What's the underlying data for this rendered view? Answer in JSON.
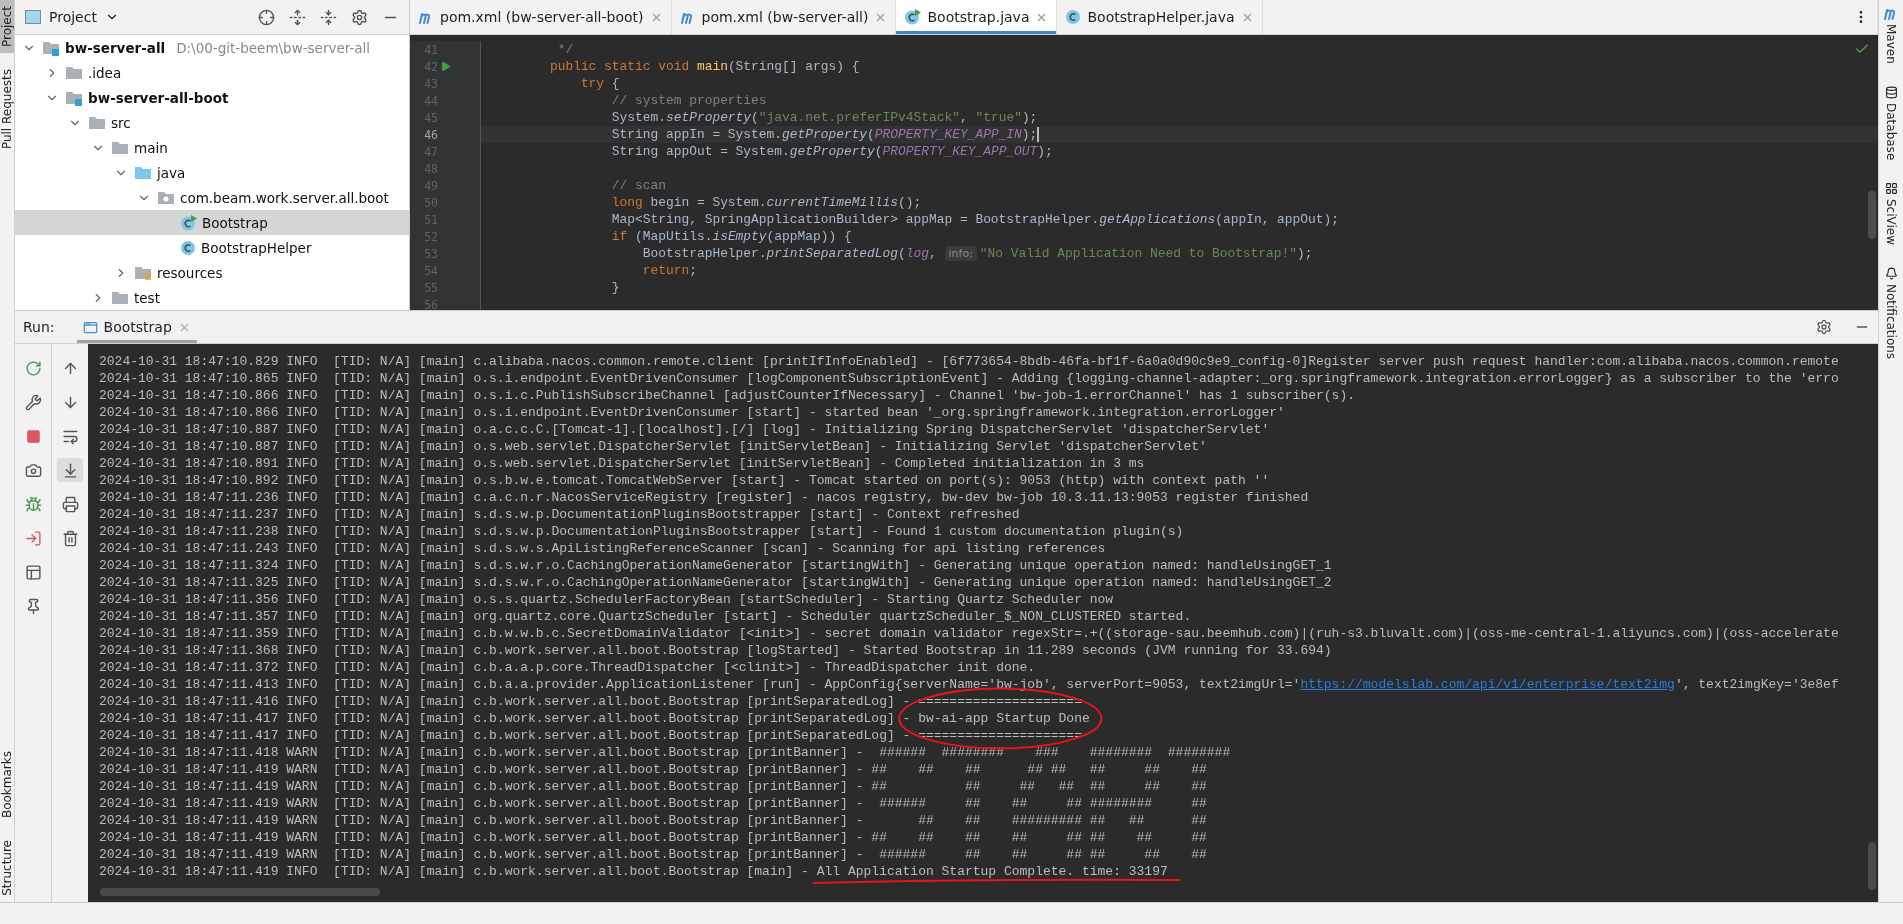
{
  "left_strip": [
    {
      "label": "Project",
      "selected": true
    },
    {
      "label": "Pull Requests",
      "selected": false
    },
    {
      "label": "Bookmarks",
      "selected": false
    },
    {
      "label": "Structure",
      "selected": false
    }
  ],
  "project": {
    "title": "Project",
    "tree": [
      {
        "label": "bw-server-all",
        "hint": "D:\\00-git-beem\\bw-server-all",
        "kind": "module",
        "expanded": true,
        "selected": false,
        "children": [
          {
            "label": ".idea",
            "kind": "folder",
            "expanded": false,
            "selected": false
          },
          {
            "label": "bw-server-all-boot",
            "kind": "module",
            "expanded": true,
            "selected": false,
            "children": [
              {
                "label": "src",
                "kind": "folder",
                "expanded": true,
                "selected": false,
                "children": [
                  {
                    "label": "main",
                    "kind": "folder",
                    "expanded": true,
                    "selected": false,
                    "children": [
                      {
                        "label": "java",
                        "kind": "source-folder",
                        "expanded": true,
                        "selected": false,
                        "children": [
                          {
                            "label": "com.beam.work.server.all.boot",
                            "kind": "package",
                            "expanded": true,
                            "selected": false,
                            "children": [
                              {
                                "label": "Bootstrap",
                                "kind": "class-run",
                                "selected": true
                              },
                              {
                                "label": "BootstrapHelper",
                                "kind": "class",
                                "selected": false
                              }
                            ]
                          }
                        ]
                      },
                      {
                        "label": "resources",
                        "kind": "resources-folder",
                        "expanded": false,
                        "selected": false
                      }
                    ]
                  },
                  {
                    "label": "test",
                    "kind": "folder",
                    "expanded": false,
                    "selected": false
                  }
                ]
              }
            ]
          }
        ]
      }
    ]
  },
  "editor": {
    "tabs": [
      {
        "label": "pom.xml (bw-server-all-boot)",
        "kind": "maven",
        "selected": false
      },
      {
        "label": "pom.xml (bw-server-all)",
        "kind": "maven",
        "selected": false
      },
      {
        "label": "Bootstrap.java",
        "kind": "class-run",
        "selected": true
      },
      {
        "label": "BootstrapHelper.java",
        "kind": "class",
        "selected": false
      }
    ],
    "lines": [
      {
        "number": "41",
        "current": false,
        "tokens": [
          {
            "kind": "comment",
            "text": "     */"
          }
        ]
      },
      {
        "number": "42",
        "current": false,
        "run": true,
        "tokens": [
          {
            "kind": "keyword",
            "text": "    public static void "
          },
          {
            "kind": "declaration",
            "text": "main"
          },
          {
            "kind": "plain",
            "text": "(String[] args) {"
          }
        ]
      },
      {
        "number": "43",
        "current": false,
        "tokens": [
          {
            "kind": "keyword",
            "text": "        try"
          },
          {
            "kind": "plain",
            "text": " {"
          }
        ]
      },
      {
        "number": "44",
        "current": false,
        "tokens": [
          {
            "kind": "comment",
            "text": "            // system properties"
          }
        ]
      },
      {
        "number": "45",
        "current": false,
        "tokens": [
          {
            "kind": "plain",
            "text": "            System."
          },
          {
            "kind": "static-call",
            "text": "setProperty"
          },
          {
            "kind": "plain",
            "text": "("
          },
          {
            "kind": "string",
            "text": "\"java.net.preferIPv4Stack\""
          },
          {
            "kind": "plain",
            "text": ", "
          },
          {
            "kind": "string",
            "text": "\"true\""
          },
          {
            "kind": "plain",
            "text": ");"
          }
        ]
      },
      {
        "number": "46",
        "current": true,
        "tokens": [
          {
            "kind": "plain",
            "text": "            String appIn = System."
          },
          {
            "kind": "static-call",
            "text": "getProperty"
          },
          {
            "kind": "plain",
            "text": "("
          },
          {
            "kind": "constant",
            "text": "PROPERTY_KEY_APP_IN"
          },
          {
            "kind": "plain",
            "text": ");"
          }
        ]
      },
      {
        "number": "47",
        "current": false,
        "tokens": [
          {
            "kind": "plain",
            "text": "            String appOut = System."
          },
          {
            "kind": "static-call",
            "text": "getProperty"
          },
          {
            "kind": "plain",
            "text": "("
          },
          {
            "kind": "constant",
            "text": "PROPERTY_KEY_APP_OUT"
          },
          {
            "kind": "plain",
            "text": ");"
          }
        ]
      },
      {
        "number": "48",
        "current": false
      },
      {
        "number": "49",
        "current": false,
        "tokens": [
          {
            "kind": "comment",
            "text": "            // scan"
          }
        ]
      },
      {
        "number": "50",
        "current": false,
        "tokens": [
          {
            "kind": "keyword",
            "text": "            long"
          },
          {
            "kind": "plain",
            "text": " begin = System."
          },
          {
            "kind": "static-call",
            "text": "currentTimeMillis"
          },
          {
            "kind": "plain",
            "text": "();"
          }
        ]
      },
      {
        "number": "51",
        "current": false,
        "tokens": [
          {
            "kind": "plain",
            "text": "            Map<String, SpringApplicationBuilder> appMap = BootstrapHelper."
          },
          {
            "kind": "static-call",
            "text": "getApplications"
          },
          {
            "kind": "plain",
            "text": "(appIn, appOut);"
          }
        ]
      },
      {
        "number": "52",
        "current": false,
        "tokens": [
          {
            "kind": "keyword",
            "text": "            if"
          },
          {
            "kind": "plain",
            "text": " (MapUtils."
          },
          {
            "kind": "static-call",
            "text": "isEmpty"
          },
          {
            "kind": "plain",
            "text": "(appMap)) {"
          }
        ]
      },
      {
        "number": "53",
        "current": false,
        "tokens": [
          {
            "kind": "plain",
            "text": "                BootstrapHelper."
          },
          {
            "kind": "static-call",
            "text": "printSeparatedLog"
          },
          {
            "kind": "plain",
            "text": "("
          },
          {
            "kind": "constant",
            "text": "log"
          },
          {
            "kind": "plain",
            "text": ", "
          },
          {
            "kind": "hint",
            "text": "info:"
          },
          {
            "kind": "string",
            "text": "\"No Valid Application Need to Bootstrap!\""
          },
          {
            "kind": "plain",
            "text": ");"
          }
        ]
      },
      {
        "number": "54",
        "current": false,
        "tokens": [
          {
            "kind": "keyword",
            "text": "                return"
          },
          {
            "kind": "plain",
            "text": ";"
          }
        ]
      },
      {
        "number": "55",
        "current": false,
        "tokens": [
          {
            "kind": "plain",
            "text": "            }"
          }
        ]
      },
      {
        "number": "56",
        "current": false
      }
    ]
  },
  "right_strip": [
    {
      "label": "Maven",
      "kind": "maven"
    },
    {
      "label": "Database",
      "kind": "database"
    },
    {
      "label": "SciView",
      "kind": "sciview"
    },
    {
      "label": "Notifications",
      "kind": "notifications"
    }
  ],
  "run": {
    "label": "Run:",
    "tab": "Bootstrap",
    "lines": [
      {
        "circled": false,
        "underlined": false,
        "segments": [
          {
            "kind": "plain",
            "text": "2024-10-31 18:47:10.829 INFO  [TID: N/A] [main] c.alibaba.nacos.common.remote.client [printIfInfoEnabled] - [6f773654-8bdb-46fa-bf1f-6a0a0d90c9e9_config-0]Register server push request handler:com.alibaba.nacos.common.remote"
          }
        ]
      },
      {
        "circled": false,
        "underlined": false,
        "segments": [
          {
            "kind": "plain",
            "text": "2024-10-31 18:47:10.865 INFO  [TID: N/A] [main] o.s.i.endpoint.EventDrivenConsumer [logComponentSubscriptionEvent] - Adding {logging-channel-adapter:_org.springframework.integration.errorLogger} as a subscriber to the 'erro"
          }
        ]
      },
      {
        "circled": false,
        "underlined": false,
        "segments": [
          {
            "kind": "plain",
            "text": "2024-10-31 18:47:10.866 INFO  [TID: N/A] [main] o.s.i.c.PublishSubscribeChannel [adjustCounterIfNecessary] - Channel 'bw-job-1.errorChannel' has 1 subscriber(s)."
          }
        ]
      },
      {
        "circled": false,
        "underlined": false,
        "segments": [
          {
            "kind": "plain",
            "text": "2024-10-31 18:47:10.866 INFO  [TID: N/A] [main] o.s.i.endpoint.EventDrivenConsumer [start] - started bean '_org.springframework.integration.errorLogger'"
          }
        ]
      },
      {
        "circled": false,
        "underlined": false,
        "segments": [
          {
            "kind": "plain",
            "text": "2024-10-31 18:47:10.887 INFO  [TID: N/A] [main] o.a.c.c.C.[Tomcat-1].[localhost].[/] [log] - Initializing Spring DispatcherServlet 'dispatcherServlet'"
          }
        ]
      },
      {
        "circled": false,
        "underlined": false,
        "segments": [
          {
            "kind": "plain",
            "text": "2024-10-31 18:47:10.887 INFO  [TID: N/A] [main] o.s.web.servlet.DispatcherServlet [initServletBean] - Initializing Servlet 'dispatcherServlet'"
          }
        ]
      },
      {
        "circled": false,
        "underlined": false,
        "segments": [
          {
            "kind": "plain",
            "text": "2024-10-31 18:47:10.891 INFO  [TID: N/A] [main] o.s.web.servlet.DispatcherServlet [initServletBean] - Completed initialization in 3 ms"
          }
        ]
      },
      {
        "circled": false,
        "underlined": false,
        "segments": [
          {
            "kind": "plain",
            "text": "2024-10-31 18:47:10.892 INFO  [TID: N/A] [main] o.s.b.w.e.tomcat.TomcatWebServer [start] - Tomcat started on port(s): 9053 (http) with context path ''"
          }
        ]
      },
      {
        "circled": false,
        "underlined": false,
        "segments": [
          {
            "kind": "plain",
            "text": "2024-10-31 18:47:11.236 INFO  [TID: N/A] [main] c.a.c.n.r.NacosServiceRegistry [register] - nacos registry, bw-dev bw-job 10.3.11.13:9053 register finished"
          }
        ]
      },
      {
        "circled": false,
        "underlined": false,
        "segments": [
          {
            "kind": "plain",
            "text": "2024-10-31 18:47:11.237 INFO  [TID: N/A] [main] s.d.s.w.p.DocumentationPluginsBootstrapper [start] - Context refreshed"
          }
        ]
      },
      {
        "circled": false,
        "underlined": false,
        "segments": [
          {
            "kind": "plain",
            "text": "2024-10-31 18:47:11.238 INFO  [TID: N/A] [main] s.d.s.w.p.DocumentationPluginsBootstrapper [start] - Found 1 custom documentation plugin(s)"
          }
        ]
      },
      {
        "circled": false,
        "underlined": false,
        "segments": [
          {
            "kind": "plain",
            "text": "2024-10-31 18:47:11.243 INFO  [TID: N/A] [main] s.d.s.w.s.ApiListingReferenceScanner [scan] - Scanning for api listing references"
          }
        ]
      },
      {
        "circled": false,
        "underlined": false,
        "segments": [
          {
            "kind": "plain",
            "text": "2024-10-31 18:47:11.324 INFO  [TID: N/A] [main] s.d.s.w.r.o.CachingOperationNameGenerator [startingWith] - Generating unique operation named: handleUsingGET_1"
          }
        ]
      },
      {
        "circled": false,
        "underlined": false,
        "segments": [
          {
            "kind": "plain",
            "text": "2024-10-31 18:47:11.325 INFO  [TID: N/A] [main] s.d.s.w.r.o.CachingOperationNameGenerator [startingWith] - Generating unique operation named: handleUsingGET_2"
          }
        ]
      },
      {
        "circled": false,
        "underlined": false,
        "segments": [
          {
            "kind": "plain",
            "text": "2024-10-31 18:47:11.356 INFO  [TID: N/A] [main] o.s.s.quartz.SchedulerFactoryBean [startScheduler] - Starting Quartz Scheduler now"
          }
        ]
      },
      {
        "circled": false,
        "underlined": false,
        "segments": [
          {
            "kind": "plain",
            "text": "2024-10-31 18:47:11.357 INFO  [TID: N/A] [main] org.quartz.core.QuartzScheduler [start] - Scheduler quartzScheduler_$_NON_CLUSTERED started."
          }
        ]
      },
      {
        "circled": false,
        "underlined": false,
        "segments": [
          {
            "kind": "plain",
            "text": "2024-10-31 18:47:11.359 INFO  [TID: N/A] [main] c.b.w.w.b.c.SecretDomainValidator [<init>] - secret domain validator regexStr=.+((storage-sau.beemhub.com)|(ruh-s3.bluvalt.com)|(oss-me-central-1.aliyuncs.com)|(oss-accelerate"
          }
        ]
      },
      {
        "circled": false,
        "underlined": false,
        "segments": [
          {
            "kind": "plain",
            "text": "2024-10-31 18:47:11.368 INFO  [TID: N/A] [main] c.b.work.server.all.boot.Bootstrap [logStarted] - Started Bootstrap in 11.289 seconds (JVM running for 33.694)"
          }
        ]
      },
      {
        "circled": false,
        "underlined": false,
        "segments": [
          {
            "kind": "plain",
            "text": "2024-10-31 18:47:11.372 INFO  [TID: N/A] [main] c.b.a.a.p.core.ThreadDispatcher [<clinit>] - ThreadDispatcher init done."
          }
        ]
      },
      {
        "circled": false,
        "underlined": false,
        "segments": [
          {
            "kind": "plain",
            "text": "2024-10-31 18:47:11.413 INFO  [TID: N/A] [main] c.b.a.a.provider.ApplicationListener [run] - AppConfig{serverName='bw-job', serverPort=9053, text2imgUrl='"
          },
          {
            "kind": "link",
            "text": "https://modelslab.com/api/v1/enterprise/text2img"
          },
          {
            "kind": "plain",
            "text": "', text2imgKey='3e8ef"
          }
        ]
      },
      {
        "circled": true,
        "underlined": false,
        "segments": [
          {
            "kind": "plain",
            "text": "2024-10-31 18:47:11.416 INFO  [TID: N/A] [main] c.b.work.server.all.boot.Bootstrap [printSeparatedLog] "
          },
          {
            "kind": "plain",
            "text": "- ====================="
          }
        ]
      },
      {
        "circled": true,
        "underlined": false,
        "segments": [
          {
            "kind": "plain",
            "text": "2024-10-31 18:47:11.417 INFO  [TID: N/A] [main] c.b.work.server.all.boot.Bootstrap [printSeparatedLog] "
          },
          {
            "kind": "plain",
            "text": "- bw-ai-app Startup Done"
          }
        ]
      },
      {
        "circled": true,
        "underlined": false,
        "segments": [
          {
            "kind": "plain",
            "text": "2024-10-31 18:47:11.417 INFO  [TID: N/A] [main] c.b.work.server.all.boot.Bootstrap [printSeparatedLog] "
          },
          {
            "kind": "plain",
            "text": "- ====================="
          }
        ]
      },
      {
        "circled": false,
        "underlined": false,
        "segments": [
          {
            "kind": "plain",
            "text": "2024-10-31 18:47:11.418 WARN  [TID: N/A] [main] c.b.work.server.all.boot.Bootstrap [printBanner] -  ######  ########    ###    ########  ########"
          }
        ]
      },
      {
        "circled": false,
        "underlined": false,
        "segments": [
          {
            "kind": "plain",
            "text": "2024-10-31 18:47:11.419 WARN  [TID: N/A] [main] c.b.work.server.all.boot.Bootstrap [printBanner] - ##    ##    ##      ## ##   ##     ##    ##"
          }
        ]
      },
      {
        "circled": false,
        "underlined": false,
        "segments": [
          {
            "kind": "plain",
            "text": "2024-10-31 18:47:11.419 WARN  [TID: N/A] [main] c.b.work.server.all.boot.Bootstrap [printBanner] - ##          ##     ##   ##  ##     ##    ##"
          }
        ]
      },
      {
        "circled": false,
        "underlined": false,
        "segments": [
          {
            "kind": "plain",
            "text": "2024-10-31 18:47:11.419 WARN  [TID: N/A] [main] c.b.work.server.all.boot.Bootstrap [printBanner] -  ######     ##    ##     ## ########     ##"
          }
        ]
      },
      {
        "circled": false,
        "underlined": false,
        "segments": [
          {
            "kind": "plain",
            "text": "2024-10-31 18:47:11.419 WARN  [TID: N/A] [main] c.b.work.server.all.boot.Bootstrap [printBanner] -       ##    ##    ######### ##   ##      ##"
          }
        ]
      },
      {
        "circled": false,
        "underlined": false,
        "segments": [
          {
            "kind": "plain",
            "text": "2024-10-31 18:47:11.419 WARN  [TID: N/A] [main] c.b.work.server.all.boot.Bootstrap [printBanner] - ##    ##    ##    ##     ## ##    ##     ##"
          }
        ]
      },
      {
        "circled": false,
        "underlined": false,
        "segments": [
          {
            "kind": "plain",
            "text": "2024-10-31 18:47:11.419 WARN  [TID: N/A] [main] c.b.work.server.all.boot.Bootstrap [printBanner] -  ######     ##    ##     ## ##     ##    ##"
          }
        ]
      },
      {
        "circled": false,
        "underlined": true,
        "segments": [
          {
            "kind": "plain",
            "text": "2024-10-31 18:47:11.419 INFO  [TID: N/A] [main] c.b.work.server.all.boot.Bootstrap [main] - "
          },
          {
            "kind": "plain",
            "text": "All Application Startup Complete. time: 33197"
          }
        ]
      }
    ]
  }
}
